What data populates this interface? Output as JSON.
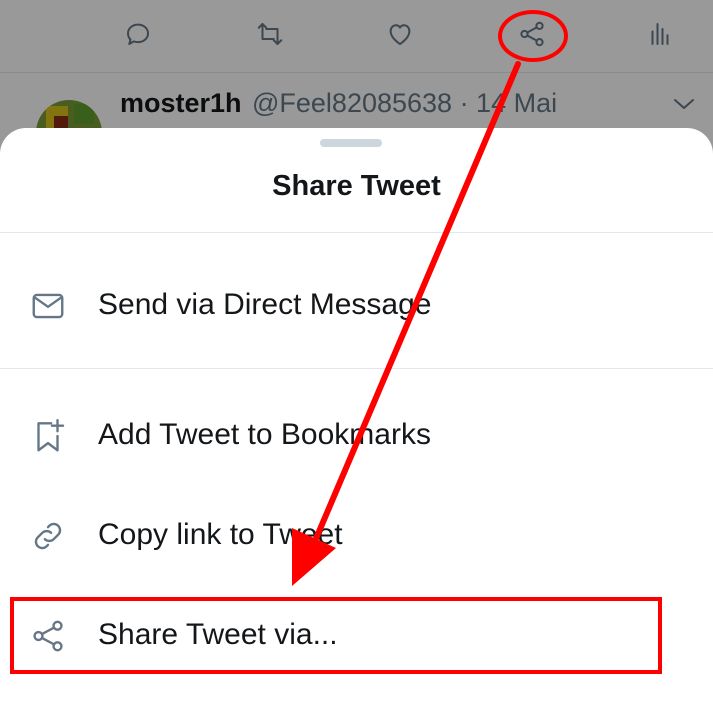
{
  "tweet_actions": {
    "icons": [
      "reply-icon",
      "retweet-icon",
      "like-icon",
      "share-icon",
      "analytics-icon"
    ]
  },
  "tweet": {
    "author": "moster1h",
    "handle_and_date": "@Feel82085638 · 14 Mai"
  },
  "sheet": {
    "title": "Share Tweet",
    "items": [
      {
        "label": "Send via Direct Message",
        "icon": "mail-icon"
      },
      {
        "label": "Add Tweet to Bookmarks",
        "icon": "bookmark-add-icon"
      },
      {
        "label": "Copy link to Tweet",
        "icon": "link-icon"
      },
      {
        "label": "Share Tweet via...",
        "icon": "share-icon"
      }
    ]
  },
  "colors": {
    "annotation": "#ff0000",
    "text": "#14171a",
    "icon": "#657786",
    "overlay": "rgba(0,0,0,0.40)"
  }
}
